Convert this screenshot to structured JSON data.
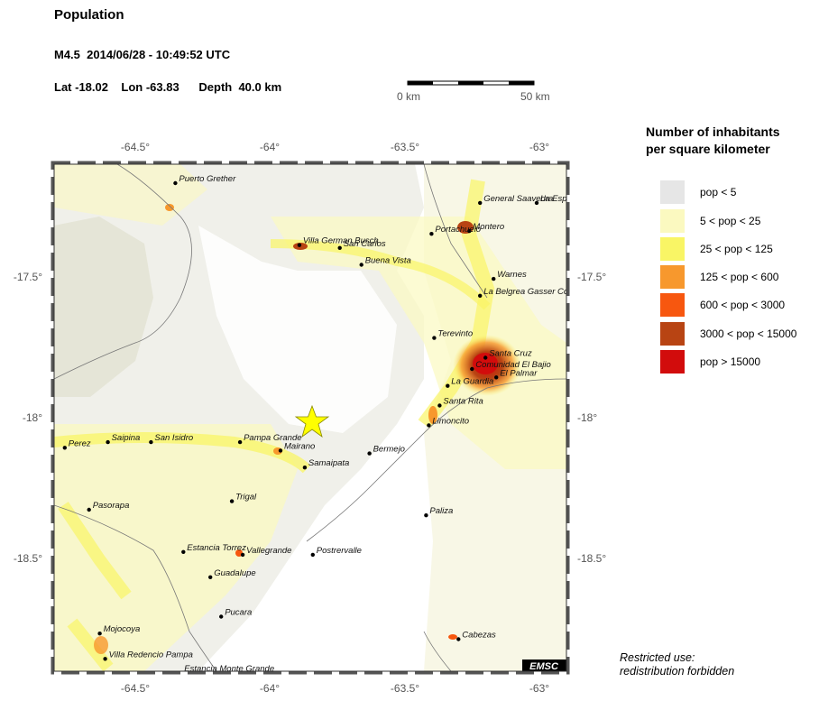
{
  "header": {
    "title": "Population",
    "event": "M4.5  2014/06/28 - 10:49:52 UTC",
    "location": "Lat -18.02    Lon -63.83      Depth  40.0 km"
  },
  "scale_bar": {
    "start_label": "0 km",
    "end_label": "50 km"
  },
  "map": {
    "lon_ticks": [
      "-64.5°",
      "-64°",
      "-63.5°",
      "-63°"
    ],
    "lat_ticks": [
      "-17.5°",
      "-18°",
      "-18.5°"
    ],
    "epicenter": {
      "lat": -18.02,
      "lon": -63.83,
      "color": "#ffff00"
    },
    "logo": "EMSC",
    "cities": [
      {
        "name": "Puerto Grether",
        "lon": -64.35,
        "lat": -17.17
      },
      {
        "name": "General Saavedra",
        "lon": -63.22,
        "lat": -17.24
      },
      {
        "name": "La Esp",
        "lon": -63.01,
        "lat": -17.24
      },
      {
        "name": "Montero",
        "lon": -63.26,
        "lat": -17.34
      },
      {
        "name": "Portachuelo",
        "lon": -63.4,
        "lat": -17.35
      },
      {
        "name": "Villa German Busch",
        "lon": -63.89,
        "lat": -17.39
      },
      {
        "name": "San Carlos",
        "lon": -63.74,
        "lat": -17.4
      },
      {
        "name": "Buena Vista",
        "lon": -63.66,
        "lat": -17.46
      },
      {
        "name": "Warnes",
        "lon": -63.17,
        "lat": -17.51
      },
      {
        "name": "La Belgrea Gasser Co",
        "lon": -63.22,
        "lat": -17.57
      },
      {
        "name": "Terevinto",
        "lon": -63.39,
        "lat": -17.72
      },
      {
        "name": "Santa Cruz",
        "lon": -63.2,
        "lat": -17.79
      },
      {
        "name": "Comunidad El Bajio",
        "lon": -63.25,
        "lat": -17.83
      },
      {
        "name": "El Palmar",
        "lon": -63.16,
        "lat": -17.86
      },
      {
        "name": "La Guardia",
        "lon": -63.34,
        "lat": -17.89
      },
      {
        "name": "Santa Rita",
        "lon": -63.37,
        "lat": -17.96
      },
      {
        "name": "Limoncito",
        "lon": -63.41,
        "lat": -18.03
      },
      {
        "name": "Perez",
        "lon": -64.76,
        "lat": -18.11
      },
      {
        "name": "Saipina",
        "lon": -64.6,
        "lat": -18.09
      },
      {
        "name": "San Isidro",
        "lon": -64.44,
        "lat": -18.09
      },
      {
        "name": "Pampa Grande",
        "lon": -64.11,
        "lat": -18.09
      },
      {
        "name": "Mairano",
        "lon": -63.96,
        "lat": -18.12
      },
      {
        "name": "Bermejo",
        "lon": -63.63,
        "lat": -18.13
      },
      {
        "name": "Samaipata",
        "lon": -63.87,
        "lat": -18.18
      },
      {
        "name": "Trigal",
        "lon": -64.14,
        "lat": -18.3
      },
      {
        "name": "Pasorapa",
        "lon": -64.67,
        "lat": -18.33
      },
      {
        "name": "Paliza",
        "lon": -63.42,
        "lat": -18.35
      },
      {
        "name": "Estancia Torrez",
        "lon": -64.32,
        "lat": -18.48
      },
      {
        "name": "Vallegrande",
        "lon": -64.1,
        "lat": -18.49
      },
      {
        "name": "Postrervalle",
        "lon": -63.84,
        "lat": -18.49
      },
      {
        "name": "Guadalupe",
        "lon": -64.22,
        "lat": -18.57
      },
      {
        "name": "Pucara",
        "lon": -64.18,
        "lat": -18.71
      },
      {
        "name": "Mojocoya",
        "lon": -64.63,
        "lat": -18.77
      },
      {
        "name": "Cabezas",
        "lon": -63.3,
        "lat": -18.79
      },
      {
        "name": "Villa Redencio Pampa",
        "lon": -64.61,
        "lat": -18.86
      },
      {
        "name": "Estancia Monte Grande",
        "lon": -64.33,
        "lat": -18.91
      }
    ]
  },
  "legend": {
    "title_line1": "Number of inhabitants",
    "title_line2": "per square kilometer",
    "items": [
      {
        "label": "pop < 5",
        "color": "#e6e6e6"
      },
      {
        "label": "5 < pop < 25",
        "color": "#fbf9c0"
      },
      {
        "label": "25 < pop < 125",
        "color": "#f9f565"
      },
      {
        "label": "125 < pop < 600",
        "color": "#f7982d"
      },
      {
        "label": "600 < pop < 3000",
        "color": "#f7570f"
      },
      {
        "label": "3000 < pop < 15000",
        "color": "#b84413"
      },
      {
        "label": "pop > 15000",
        "color": "#d20c0c"
      }
    ]
  },
  "footer": {
    "restricted_line1": "Restricted use:",
    "restricted_line2": "redistribution forbidden"
  }
}
